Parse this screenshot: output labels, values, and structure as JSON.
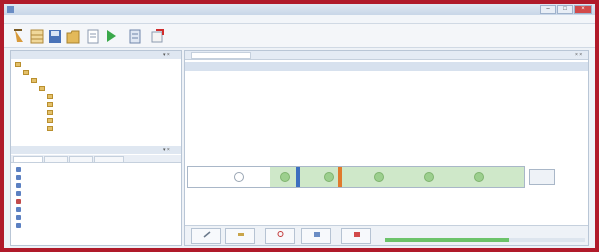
{
  "window": {
    "title": ""
  },
  "menu": [
    {
      "label": ""
    },
    {
      "label": ""
    },
    {
      "label": ""
    },
    {
      "label": ""
    },
    {
      "label": ""
    },
    {
      "label": ""
    }
  ],
  "toolbar": {
    "buttons": [
      {
        "icon": "experiment-icon"
      },
      {
        "icon": "table-icon"
      },
      {
        "icon": "save-icon"
      },
      {
        "icon": "folder-icon"
      },
      {
        "icon": "document-icon"
      },
      {
        "icon": "play-icon"
      },
      {
        "icon": "list-icon"
      },
      {
        "icon": "export-icon"
      }
    ]
  },
  "left_panel": {
    "header": "",
    "tree": [
      {
        "label": ""
      },
      {
        "label": ""
      },
      {
        "label": ""
      },
      {
        "label": ""
      },
      {
        "label": ""
      },
      {
        "label": ""
      },
      {
        "label": ""
      },
      {
        "label": ""
      },
      {
        "label": ""
      }
    ],
    "sub_header": "",
    "tabs": [
      {
        "label": ""
      },
      {
        "label": ""
      },
      {
        "label": ""
      },
      {
        "label": ""
      }
    ],
    "list": [
      {
        "label": ""
      },
      {
        "label": ""
      },
      {
        "label": ""
      },
      {
        "label": ""
      },
      {
        "label": ""
      },
      {
        "label": ""
      },
      {
        "label": ""
      },
      {
        "label": ""
      }
    ]
  },
  "main": {
    "tab_label": "",
    "close_glyph": "× ×",
    "experiment_title": "",
    "timer": "",
    "instruction": "",
    "tube": {
      "caption": "",
      "reading": ""
    },
    "side_button": ""
  },
  "bottom": {
    "buttons": [
      {
        "icon": "pipette-icon",
        "label": ""
      },
      {
        "icon": "ruler-icon",
        "label": ""
      },
      {
        "icon": "zoom-icon",
        "label": ""
      },
      {
        "icon": "measure-icon",
        "label": ""
      },
      {
        "icon": "exit-icon",
        "label": ""
      }
    ],
    "progress_label": "",
    "progress_value": 0.62
  },
  "colors": {
    "frame": "#b01a2a",
    "powder": "#cfe8c9",
    "node": "#9ccf8e",
    "marker_blue": "#3d6fbf",
    "marker_orange": "#e07a2c"
  }
}
